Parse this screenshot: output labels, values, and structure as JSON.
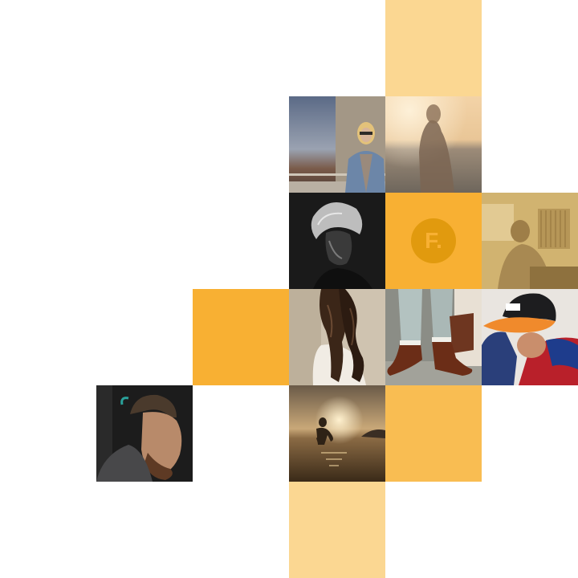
{
  "brand": {
    "logo_text": "F.",
    "accent_color": "#f8b033",
    "pale_color": "#fbd792",
    "logo_circle_color": "#e19a0e"
  },
  "tiles": [
    {
      "kind": "color",
      "subject": "pale-yellow"
    },
    {
      "kind": "photo",
      "subject": "woman-at-balcony-overlooking-sea"
    },
    {
      "kind": "photo",
      "subject": "person-silhouette-by-sea-at-sunset"
    },
    {
      "kind": "photo",
      "subject": "man-with-tousled-hair-dark-portrait"
    },
    {
      "kind": "logo",
      "subject": "brand-logo"
    },
    {
      "kind": "photo",
      "subject": "man-in-sunlit-room-sepia"
    },
    {
      "kind": "color",
      "subject": "orange"
    },
    {
      "kind": "photo",
      "subject": "woman-with-long-wavy-hair"
    },
    {
      "kind": "photo",
      "subject": "legs-in-brown-leather-shoes"
    },
    {
      "kind": "photo",
      "subject": "man-in-cap-looking-down"
    },
    {
      "kind": "photo",
      "subject": "bearded-man-profile-portrait"
    },
    {
      "kind": "photo",
      "subject": "child-in-water-at-sunset"
    },
    {
      "kind": "color",
      "subject": "light-orange"
    },
    {
      "kind": "color",
      "subject": "pale-yellow"
    }
  ]
}
